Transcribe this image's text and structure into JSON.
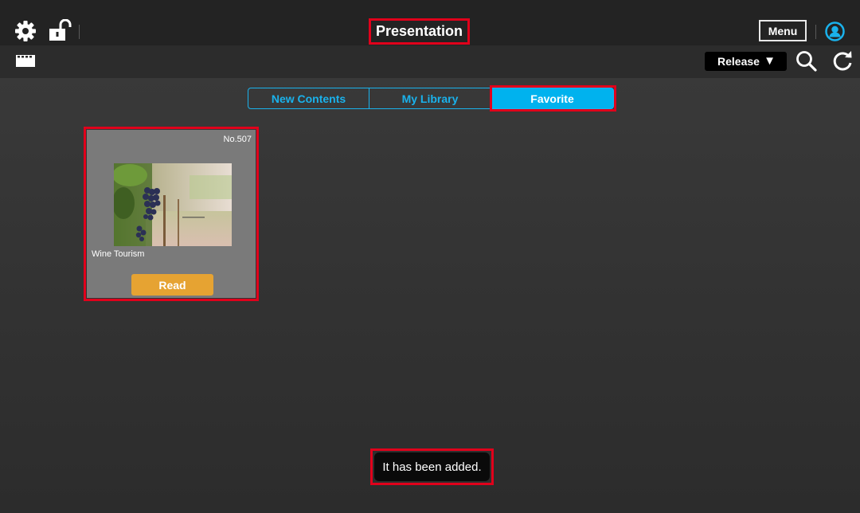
{
  "header": {
    "title": "Presentation",
    "menu_label": "Menu",
    "icons": [
      "gear-icon",
      "unlock-icon",
      "user-icon"
    ]
  },
  "subheader": {
    "release_label": "Release",
    "release_arrow": "▼",
    "icons": [
      "film-strip-icon",
      "search-icon",
      "refresh-icon"
    ]
  },
  "tabs": [
    {
      "label": "New Contents",
      "active": false
    },
    {
      "label": "My Library",
      "active": false
    },
    {
      "label": "Favorite",
      "active": true
    }
  ],
  "card": {
    "number": "No.507",
    "name": "Wine Tourism",
    "read_label": "Read",
    "thumbnail": "vineyard-grapes-image"
  },
  "toast": {
    "message": "It has been added."
  },
  "colors": {
    "accent": "#00b2ee",
    "read_button": "#e6a332",
    "highlight": "#e0001b",
    "card_bg": "#7a7a7a"
  }
}
